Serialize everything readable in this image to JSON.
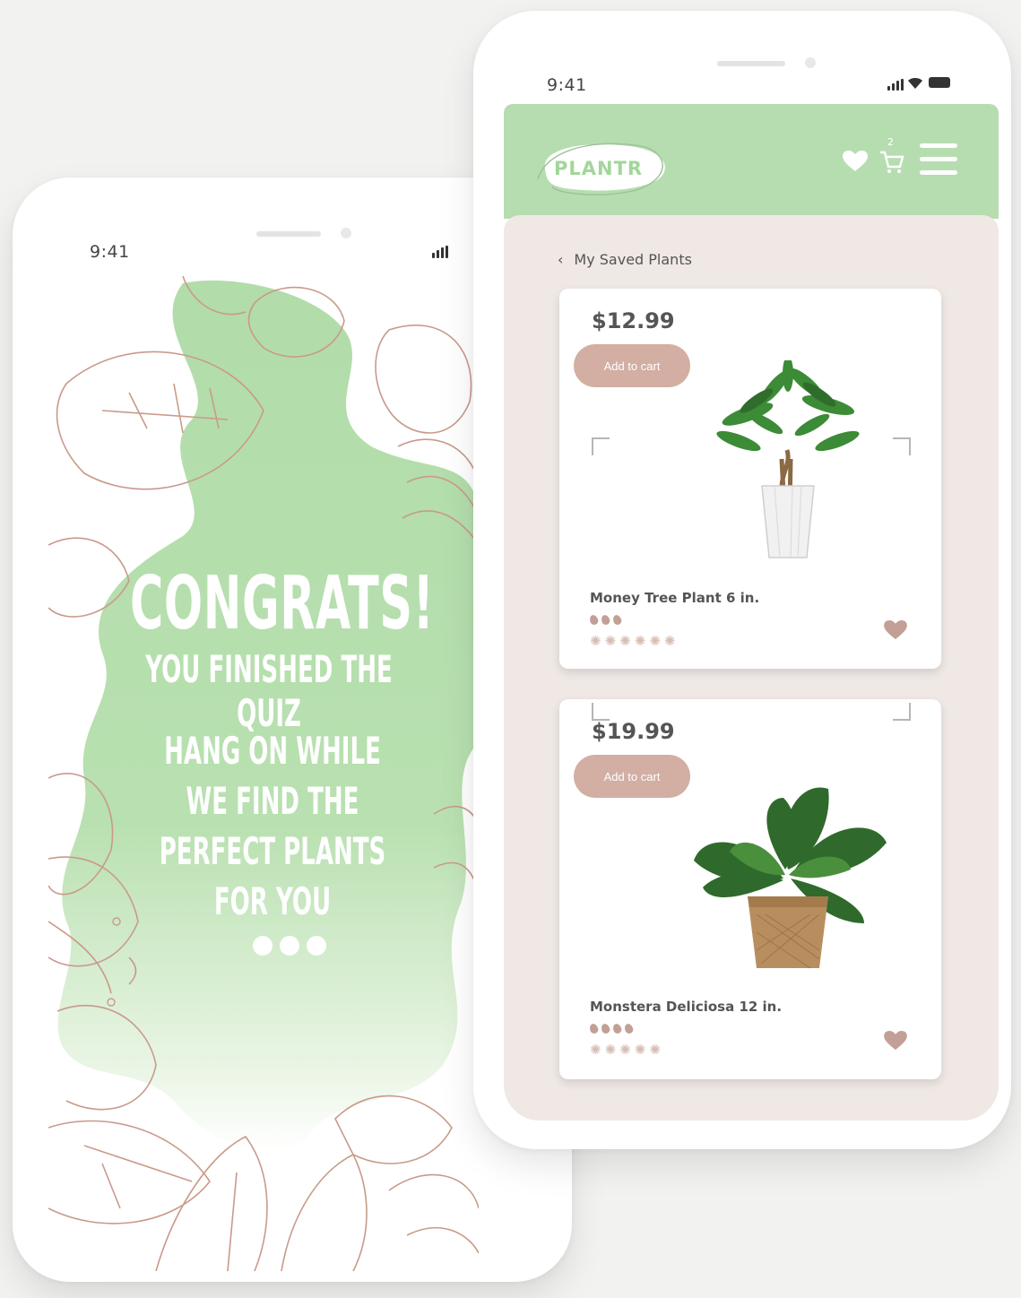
{
  "left_phone": {
    "status_time": "9:41",
    "title": "CONGRATS!",
    "subtitle": "YOU FINISHED THE QUIZ",
    "message_lines": [
      "HANG ON WHILE",
      "WE FIND THE",
      "PERFECT PLANTS",
      "FOR YOU"
    ]
  },
  "right_phone": {
    "status_time": "9:41",
    "header": {
      "logo_text": "PLANTR",
      "cart_count": "2",
      "icons": [
        "heart-icon",
        "cart-icon",
        "menu-icon"
      ]
    },
    "breadcrumb": "My Saved Plants",
    "products": [
      {
        "price": "$12.99",
        "button_label": "Add to cart",
        "name": "Money Tree Plant 6 in.",
        "water_drops": 3,
        "sun_rating": 6
      },
      {
        "price": "$19.99",
        "button_label": "Add to cart",
        "name": "Monstera Deliciosa 12 in.",
        "water_drops": 4,
        "sun_rating": 5
      }
    ]
  },
  "colors": {
    "accent_green": "#b6ddb0",
    "button_rose": "#d2aea3",
    "screen_bg": "#efe8e5",
    "outline_brown": "#c99a8a"
  }
}
